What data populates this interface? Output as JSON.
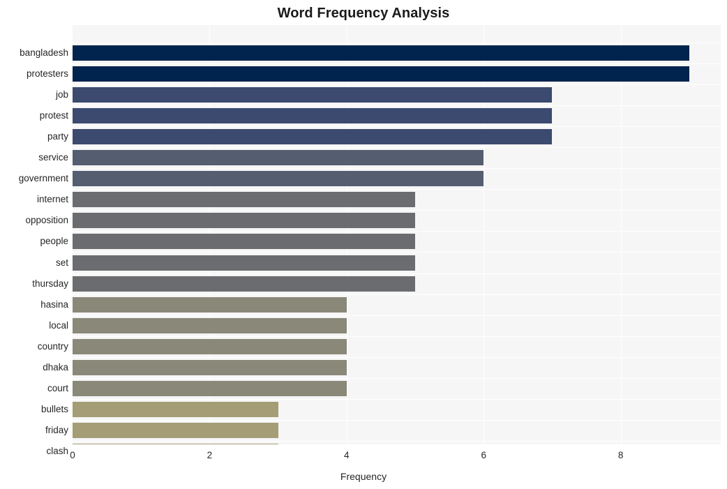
{
  "chart_data": {
    "type": "bar",
    "orientation": "horizontal",
    "title": "Word Frequency Analysis",
    "xlabel": "Frequency",
    "ylabel": "",
    "categories": [
      "bangladesh",
      "protesters",
      "job",
      "protest",
      "party",
      "service",
      "government",
      "internet",
      "opposition",
      "people",
      "set",
      "thursday",
      "hasina",
      "local",
      "country",
      "dhaka",
      "court",
      "bullets",
      "friday",
      "clash"
    ],
    "values": [
      9,
      9,
      7,
      7,
      7,
      6,
      6,
      5,
      5,
      5,
      5,
      5,
      4,
      4,
      4,
      4,
      4,
      3,
      3,
      3
    ],
    "xticks": [
      "0",
      "2",
      "4",
      "6",
      "8"
    ],
    "xtick_values": [
      0,
      2,
      4,
      6,
      8
    ],
    "xlim": [
      0,
      9.46
    ],
    "grid": true,
    "grid_color": "#ffffff",
    "plot_background": "#f6f6f7",
    "legend": "none",
    "bar_colors": [
      "#00244d",
      "#00244d",
      "#3c4a70",
      "#3c4a70",
      "#3c4a70",
      "#555d70",
      "#555d70",
      "#6b6c6f",
      "#6b6c6f",
      "#6b6c6f",
      "#6b6c6f",
      "#6b6c6f",
      "#8a8878",
      "#8a8878",
      "#8a8878",
      "#8a8878",
      "#8a8878",
      "#a49d75",
      "#a49d75",
      "#a49d75"
    ]
  }
}
